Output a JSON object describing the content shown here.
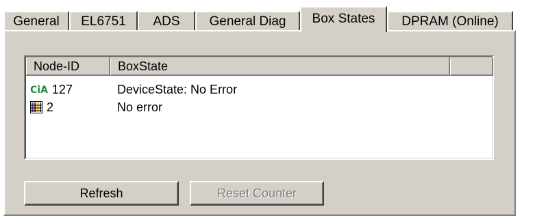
{
  "tabs": [
    {
      "label": "General"
    },
    {
      "label": "EL6751"
    },
    {
      "label": "ADS"
    },
    {
      "label": "General Diag"
    },
    {
      "label": "Box States"
    },
    {
      "label": "DPRAM (Online)"
    }
  ],
  "active_tab": "Box States",
  "list": {
    "columns": [
      "Node-ID",
      "BoxState",
      ""
    ],
    "rows": [
      {
        "icon": "cia-icon",
        "icon_text": "CiA",
        "node_id": "127",
        "state": "DeviceState: No Error"
      },
      {
        "icon": "io-box-icon",
        "node_id": "2",
        "state": "No error"
      }
    ]
  },
  "buttons": {
    "refresh": "Refresh",
    "reset_counter": "Reset Counter"
  },
  "colors": {
    "panel": "#d4d0c8",
    "cia_green": "#1f8f3a",
    "disabled_text": "#808080"
  }
}
